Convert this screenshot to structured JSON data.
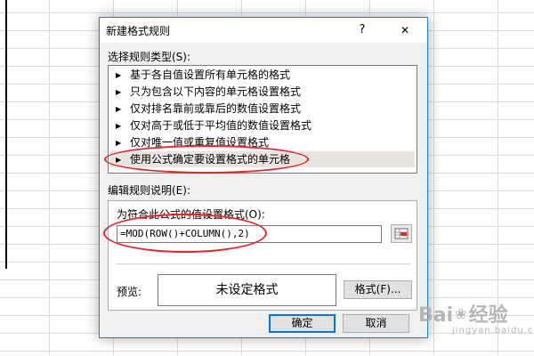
{
  "dialog": {
    "title": "新建格式规则",
    "help_label": "?",
    "close_glyph": "✕",
    "rule_type_label": "选择规则类型(S):",
    "rule_types": [
      {
        "label": "基于各自值设置所有单元格的格式"
      },
      {
        "label": "只为包含以下内容的单元格设置格式"
      },
      {
        "label": "仅对排名靠前或靠后的数值设置格式"
      },
      {
        "label": "仅对高于或低于平均值的数值设置格式"
      },
      {
        "label": "仅对唯一值或重复值设置格式"
      },
      {
        "label": "使用公式确定要设置格式的单元格",
        "selected": true
      }
    ],
    "arrow_glyph": "▶",
    "edit_label": "编辑规则说明(E):",
    "formula_label": "为符合此公式的值设置格式(O):",
    "formula_value": "=MOD(ROW()+COLUMN(),2)",
    "preview_label": "预览:",
    "preview_text": "未设定格式",
    "format_button": "格式(F)...",
    "ok_button": "确定",
    "cancel_button": "取消"
  },
  "watermark": {
    "text_left": "Bai",
    "text_right": "经验",
    "sub": "jingyan.baidu.com"
  },
  "colors": {
    "annotation": "#e5262b",
    "dialog_border": "#1883d7",
    "selected_row": "#e8e4e0"
  }
}
